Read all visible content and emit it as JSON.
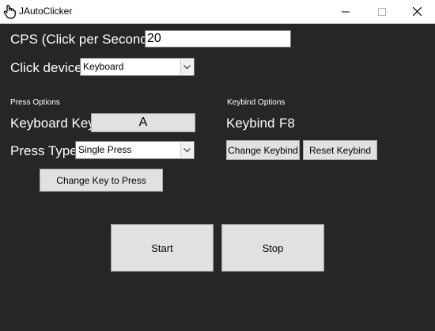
{
  "window": {
    "title": "JAutoClicker",
    "icon": "hand-pointer-icon",
    "background": "#262626"
  },
  "cps": {
    "label": "CPS (Click per Second)",
    "value": "20"
  },
  "click_device": {
    "label": "Click device",
    "selected": "Keyboard"
  },
  "press_options": {
    "heading": "Press Options",
    "keyboard_key_label": "Keyboard Key",
    "keyboard_key_value": "A",
    "press_type_label": "Press Type",
    "press_type_selected": "Single Press",
    "change_key_button": "Change Key to Press"
  },
  "keybind_options": {
    "heading": "Keybind Options",
    "keybind_label": "Keybind",
    "keybind_value": "F8",
    "change_button": "Change Keybind",
    "reset_button": "Reset Keybind"
  },
  "controls": {
    "start": "Start",
    "stop": "Stop"
  }
}
